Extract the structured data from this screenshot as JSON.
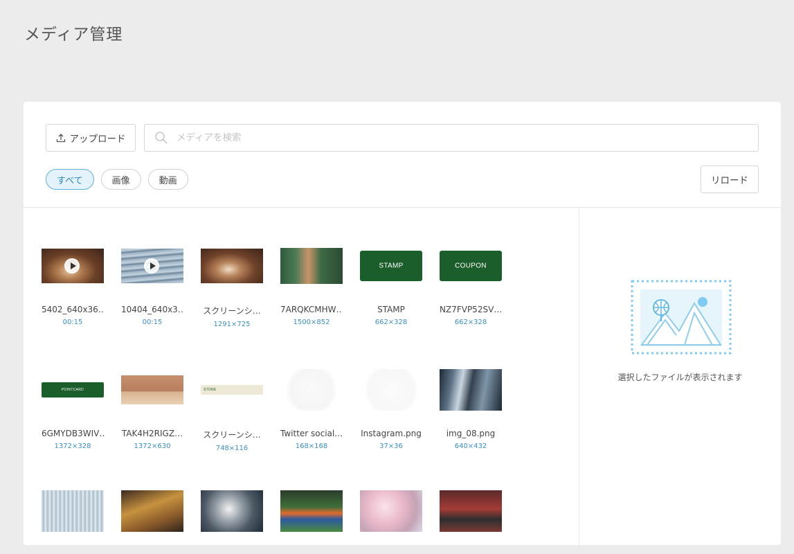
{
  "page": {
    "title": "メディア管理"
  },
  "toolbar": {
    "upload_label": "アップロード",
    "search_placeholder": "メディアを検索",
    "reload_label": "リロード"
  },
  "filters": [
    {
      "label": "すべて",
      "active": true
    },
    {
      "label": "画像",
      "active": false
    },
    {
      "label": "動画",
      "active": false
    }
  ],
  "media": [
    {
      "name": "5402_640x36…",
      "meta": "00:15",
      "type": "video",
      "thumb": "dog"
    },
    {
      "name": "10404_640x3…",
      "meta": "00:15",
      "type": "video",
      "thumb": "water"
    },
    {
      "name": "スクリーンシ…",
      "meta": "1291×725",
      "type": "image",
      "thumb": "dog"
    },
    {
      "name": "7ARQKCMHW…",
      "meta": "1500×852",
      "type": "image",
      "thumb": "room"
    },
    {
      "name": "STAMP",
      "meta": "662×328",
      "type": "image",
      "thumb": "stamp",
      "logo": "STAMP"
    },
    {
      "name": "NZ7FVP52SV…",
      "meta": "662×328",
      "type": "image",
      "thumb": "coupon",
      "logo": "COUPON"
    },
    {
      "name": "6GMYDB3WIV…",
      "meta": "1372×328",
      "type": "image",
      "thumb": "pointcard",
      "logo": "POINTCARD"
    },
    {
      "name": "TAK4H2RIGZ…",
      "meta": "1372×630",
      "type": "image",
      "thumb": "sofa"
    },
    {
      "name": "スクリーンシ…",
      "meta": "748×116",
      "type": "image",
      "thumb": "store",
      "logo": "STORE"
    },
    {
      "name": "Twitter social…",
      "meta": "168×168",
      "type": "image",
      "thumb": "blank"
    },
    {
      "name": "Instagram.png",
      "meta": "37×36",
      "type": "image",
      "thumb": "blank2"
    },
    {
      "name": "img_08.png",
      "meta": "640×432",
      "type": "image",
      "thumb": "buildings"
    },
    {
      "name": "",
      "meta": "",
      "type": "image",
      "thumb": "glass"
    },
    {
      "name": "",
      "meta": "",
      "type": "image",
      "thumb": "laptop"
    },
    {
      "name": "",
      "meta": "",
      "type": "image",
      "thumb": "typhoon"
    },
    {
      "name": "",
      "meta": "",
      "type": "image",
      "thumb": "soccer"
    },
    {
      "name": "",
      "meta": "",
      "type": "image",
      "thumb": "sakura"
    },
    {
      "name": "",
      "meta": "",
      "type": "image",
      "thumb": "athlete"
    }
  ],
  "preview": {
    "empty_text": "選択したファイルが表示されます"
  },
  "colors": {
    "accent": "#2d87b8",
    "brand_green": "#1b5e2b",
    "background": "#ececec"
  }
}
